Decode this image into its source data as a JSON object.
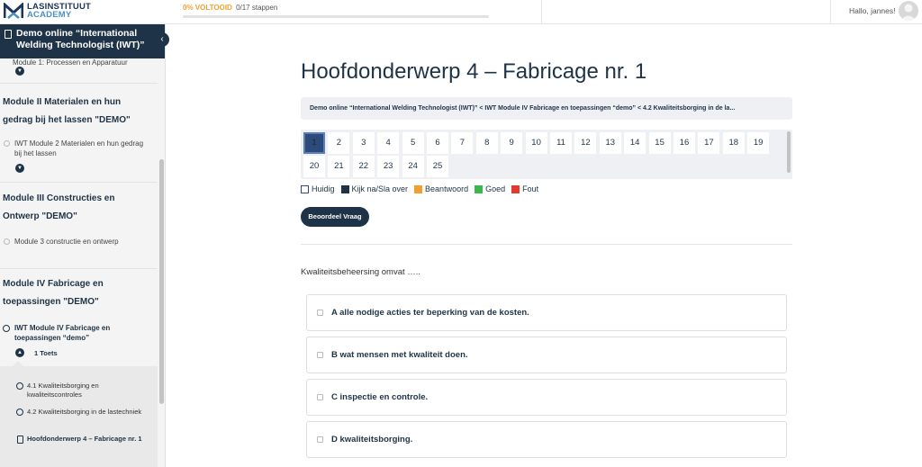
{
  "header": {
    "logo_line1": "LASINSTITUUT",
    "logo_line2": "ACADEMY",
    "progress_percent_label": "0% VOLTOOID",
    "progress_steps": "0/17 stappen",
    "progress_fraction": 0,
    "greeting": "Hallo, jannes!"
  },
  "sidebar": {
    "course_title": "Demo online “International Welding Technologist (IWT)”",
    "clipped_lesson": "Module 1: Processen en Apparatuur",
    "sections": [
      {
        "title": "Module II Materialen en hun gedrag bij het lassen \"DEMO\"",
        "lesson": "IWT Module 2 Materialen en hun gedrag bij het lassen"
      },
      {
        "title": "Module III Constructies en Ontwerp \"DEMO\"",
        "lesson": "Module 3 constructie en ontwerp"
      },
      {
        "title": "Module IV Fabricage en toepassingen \"DEMO\"",
        "lesson": "IWT Module IV Fabricage en toepassingen “demo”",
        "toets_label": "1 Toets",
        "sub_items": [
          "4.1 Kwaliteitsborging en kwaliteitscontroles",
          "4.2 Kwaliteitsborging in de lastechniek",
          "Hoofdonderwerp 4 – Fabricage nr. 1"
        ]
      }
    ]
  },
  "main": {
    "title": "Hoofdonderwerp 4 – Fabricage nr. 1",
    "breadcrumb": "Demo online “International Welding Technologist (IWT)” < IWT Module IV Fabricage en toepassingen “demo” < 4.2 Kwaliteitsborging in de la...",
    "question_numbers": [
      "1",
      "2",
      "3",
      "4",
      "5",
      "6",
      "7",
      "8",
      "9",
      "10",
      "11",
      "12",
      "13",
      "14",
      "15",
      "16",
      "17",
      "18",
      "19",
      "20",
      "21",
      "22",
      "23",
      "24",
      "25"
    ],
    "current_question": "1",
    "legend": [
      {
        "label": "Huidig",
        "color": "#ffffff"
      },
      {
        "label": "Kijk na/Sla over",
        "color": "#1e3347"
      },
      {
        "label": "Beantwoord",
        "color": "#f0a030"
      },
      {
        "label": "Goed",
        "color": "#3cb84a"
      },
      {
        "label": "Fout",
        "color": "#e03c2c"
      }
    ],
    "review_button": "Beoordeel Vraag",
    "question": "Kwaliteitsbeheersing omvat …..",
    "options": [
      "A alle nodige acties ter beperking van de kosten.",
      "B wat mensen met kwaliteit doen.",
      "C inspectie en controle.",
      "D kwaliteitsborging."
    ]
  }
}
